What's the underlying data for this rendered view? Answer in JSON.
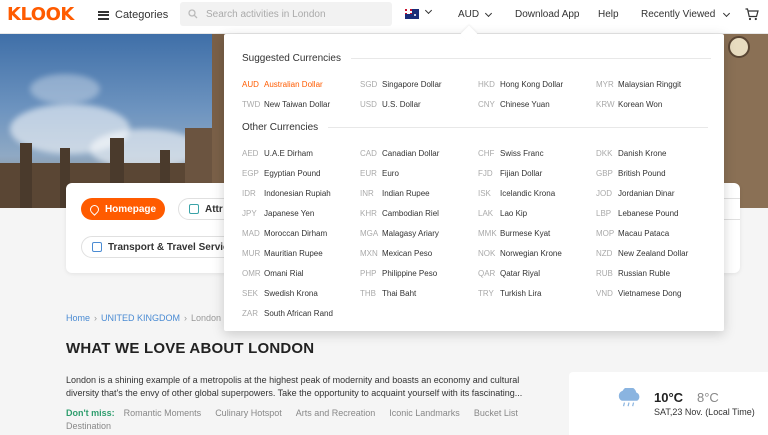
{
  "header": {
    "logo": "KLOOK",
    "categories_label": "Categories",
    "search_placeholder": "Search activities in London",
    "currency": "AUD",
    "download_app": "Download App",
    "help": "Help",
    "recently_viewed": "Recently Viewed"
  },
  "tabs": {
    "homepage": "Homepage",
    "attractions": "Attr",
    "transport": "Transport & Travel Services"
  },
  "breadcrumb": [
    "Home",
    "UNITED KINGDOM",
    "London"
  ],
  "section": {
    "title": "WHAT WE LOVE ABOUT LONDON",
    "description": "London is a shining example of a metropolis at the highest peak of modernity and boasts an economy and cultural diversity that's the envy of other global superpowers. Take the opportunity to acquaint yourself with its fascinating...",
    "dont_miss_label": "Don't miss:",
    "dont_miss": [
      "Romantic Moments",
      "Culinary Hotspot",
      "Arts and Recreation",
      "Iconic Landmarks",
      "Bucket List Destination"
    ]
  },
  "weather": {
    "high": "10°C",
    "low": "8°C",
    "date": "SAT,23 Nov. (Local Time)"
  },
  "dropdown": {
    "suggested_title": "Suggested Currencies",
    "other_title": "Other Currencies",
    "selected": "AUD",
    "suggested": [
      {
        "code": "AUD",
        "name": "Australian Dollar"
      },
      {
        "code": "SGD",
        "name": "Singapore Dollar"
      },
      {
        "code": "HKD",
        "name": "Hong Kong Dollar"
      },
      {
        "code": "MYR",
        "name": "Malaysian Ringgit"
      },
      {
        "code": "TWD",
        "name": "New Taiwan Dollar"
      },
      {
        "code": "USD",
        "name": "U.S. Dollar"
      },
      {
        "code": "CNY",
        "name": "Chinese Yuan"
      },
      {
        "code": "KRW",
        "name": "Korean Won"
      }
    ],
    "other": [
      {
        "code": "AED",
        "name": "U.A.E Dirham"
      },
      {
        "code": "CAD",
        "name": "Canadian Dollar"
      },
      {
        "code": "CHF",
        "name": "Swiss Franc"
      },
      {
        "code": "DKK",
        "name": "Danish Krone"
      },
      {
        "code": "EGP",
        "name": "Egyptian Pound"
      },
      {
        "code": "EUR",
        "name": "Euro"
      },
      {
        "code": "FJD",
        "name": "Fijian Dollar"
      },
      {
        "code": "GBP",
        "name": "British Pound"
      },
      {
        "code": "IDR",
        "name": "Indonesian Rupiah"
      },
      {
        "code": "INR",
        "name": "Indian Rupee"
      },
      {
        "code": "ISK",
        "name": "Icelandic Krona"
      },
      {
        "code": "JOD",
        "name": "Jordanian Dinar"
      },
      {
        "code": "JPY",
        "name": "Japanese Yen"
      },
      {
        "code": "KHR",
        "name": "Cambodian Riel"
      },
      {
        "code": "LAK",
        "name": "Lao Kip"
      },
      {
        "code": "LBP",
        "name": "Lebanese Pound"
      },
      {
        "code": "MAD",
        "name": "Moroccan Dirham"
      },
      {
        "code": "MGA",
        "name": "Malagasy Ariary"
      },
      {
        "code": "MMK",
        "name": "Burmese Kyat"
      },
      {
        "code": "MOP",
        "name": "Macau Pataca"
      },
      {
        "code": "MUR",
        "name": "Mauritian Rupee"
      },
      {
        "code": "MXN",
        "name": "Mexican Peso"
      },
      {
        "code": "NOK",
        "name": "Norwegian Krone"
      },
      {
        "code": "NZD",
        "name": "New Zealand Dollar"
      },
      {
        "code": "OMR",
        "name": "Omani Rial"
      },
      {
        "code": "PHP",
        "name": "Philippine Peso"
      },
      {
        "code": "QAR",
        "name": "Qatar Riyal"
      },
      {
        "code": "RUB",
        "name": "Russian Ruble"
      },
      {
        "code": "SEK",
        "name": "Swedish Krona"
      },
      {
        "code": "THB",
        "name": "Thai Baht"
      },
      {
        "code": "TRY",
        "name": "Turkish Lira"
      },
      {
        "code": "VND",
        "name": "Vietnamese Dong"
      },
      {
        "code": "ZAR",
        "name": "South African Rand"
      }
    ]
  },
  "colors": {
    "brand": "#ff5b00",
    "link": "#4a8bd3",
    "dont_miss": "#2f9e6e"
  }
}
